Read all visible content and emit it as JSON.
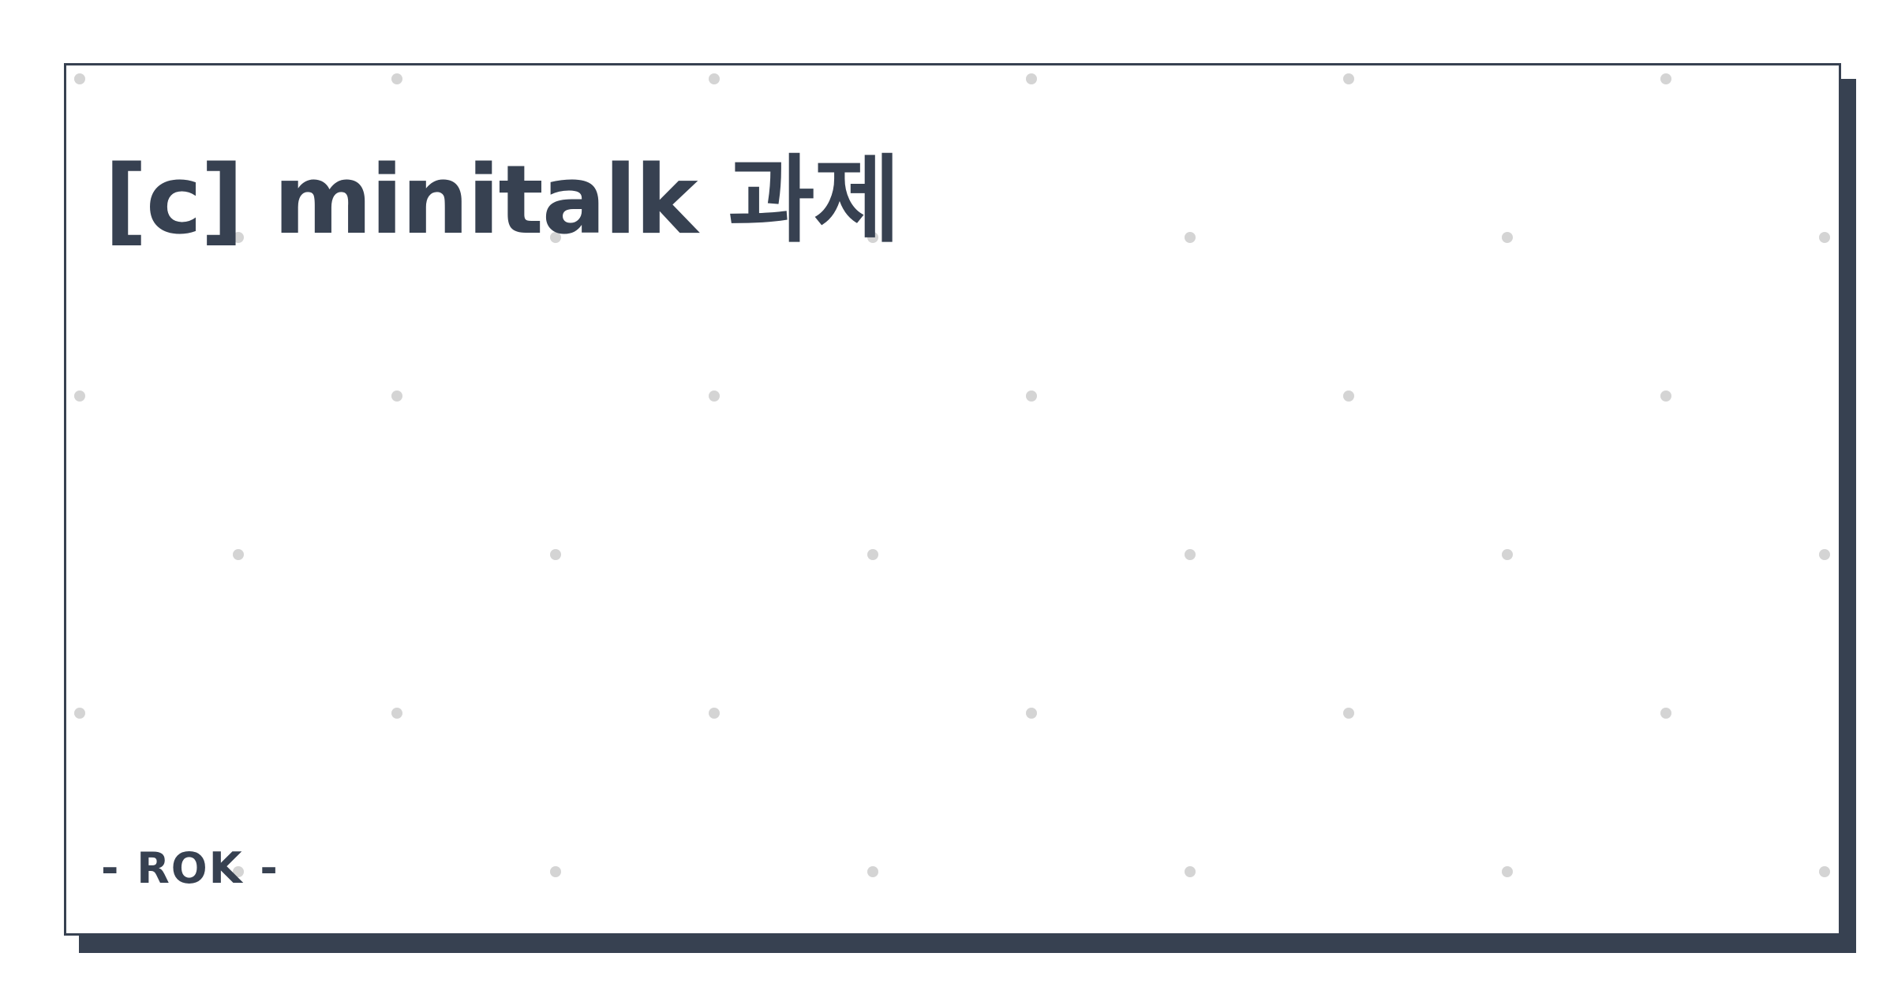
{
  "slide": {
    "title": "[c] minitalk 과제",
    "footer": "- ROK -"
  },
  "colors": {
    "text": "#374151",
    "border": "#374151",
    "shadow": "#374151",
    "background": "#ffffff",
    "dot": "#d4d4d4"
  }
}
